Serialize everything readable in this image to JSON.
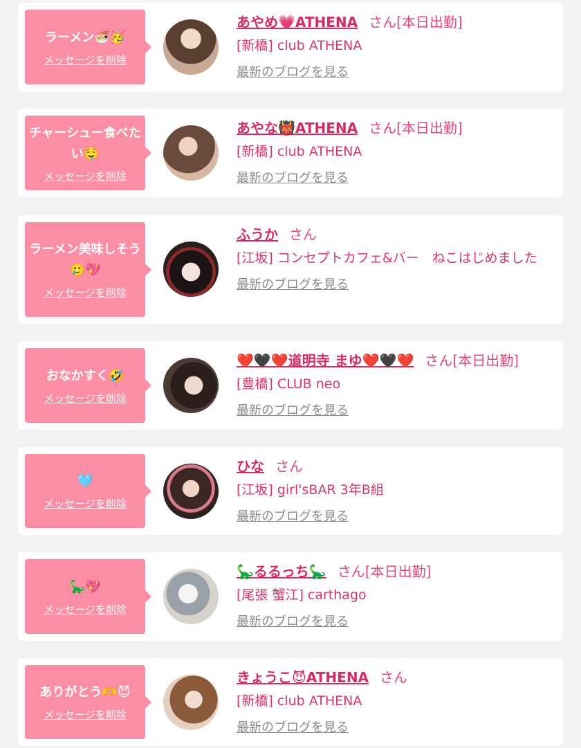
{
  "colors": {
    "background": "#f2f2f2",
    "card": "#ffffff",
    "bubble": "#fb8ea4",
    "name": "#d62a64",
    "shop": "#d6366a",
    "blog_link": "#8a8a8a"
  },
  "labels": {
    "delete": "メッセージを削除",
    "blog": "最新のブログを見る",
    "suffix": "さん"
  },
  "cards": [
    {
      "message": "ラーメン🍜🥳",
      "name": "あやめ💗ATHENA",
      "status": "[本日出勤]",
      "shop": "[新橋] club ATHENA",
      "avatar": "avatar-photo"
    },
    {
      "message": "チャーシュー食べたい🤤",
      "name": "あやな👹ATHENA",
      "status": "[本日出勤]",
      "shop": "[新橋] club ATHENA",
      "avatar": "avatar-photo"
    },
    {
      "message": "ラーメン美味しそう🥲💖",
      "name": "ふうか",
      "status": "",
      "shop": "[江坂] コンセプトカフェ&バー　ねこはじめました",
      "avatar": "avatar-photo"
    },
    {
      "message": "おなかすく🤣",
      "name": "❤️🖤❤️道明寺 まゆ❤️🖤❤️",
      "status": "[本日出勤]",
      "shop": "[豊橋] CLUB neo",
      "avatar": "avatar-photo"
    },
    {
      "message": "🩵",
      "name": "ひな",
      "status": "",
      "shop": "[江坂] girl'sBAR 3年B組",
      "avatar": "avatar-photo"
    },
    {
      "message": "🦕💖",
      "name": "🦕るるっち🦕",
      "status": "[本日出勤]",
      "shop": "[尾張 蟹江] carthago",
      "avatar": "avatar-photo"
    },
    {
      "message": "ありがとう🫶😈",
      "name": "きょうこ😈ATHENA",
      "status": "",
      "shop": "[新橋] club ATHENA",
      "avatar": "avatar-photo"
    }
  ]
}
